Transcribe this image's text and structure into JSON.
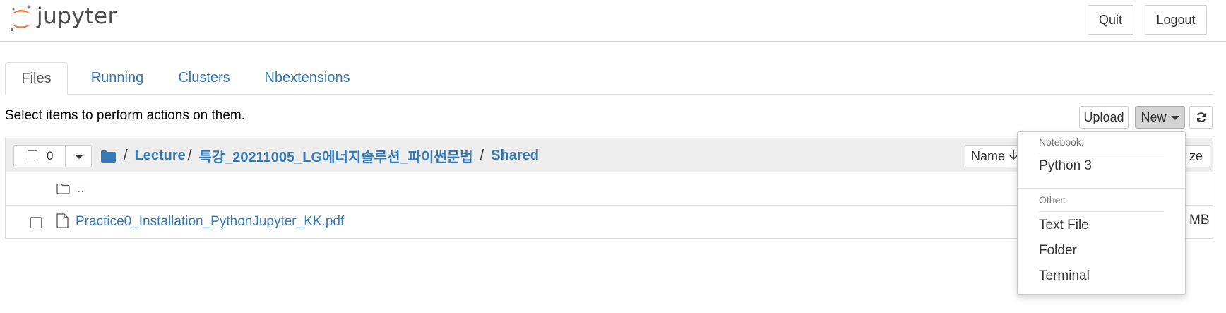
{
  "header": {
    "logo_text": "jupyter",
    "quit_label": "Quit",
    "logout_label": "Logout",
    "logo_colors": {
      "orange": "#F37726",
      "gray": "#767677"
    }
  },
  "tabs": [
    {
      "label": "Files",
      "active": true
    },
    {
      "label": "Running",
      "active": false
    },
    {
      "label": "Clusters",
      "active": false
    },
    {
      "label": "Nbextensions",
      "active": false
    }
  ],
  "toolbar": {
    "instructions": "Select items to perform actions on them.",
    "upload_label": "Upload",
    "new_label": "New",
    "refresh_icon": "refresh-icon"
  },
  "list": {
    "selected_count": "0",
    "breadcrumb": [
      {
        "label": "Lecture"
      },
      {
        "label": "특강_20211005_LG에너지솔루션_파이썬문법"
      },
      {
        "label": "Shared"
      }
    ],
    "separator": "/",
    "sort_name_label": "Name",
    "sort_size_label": "ze",
    "rows": [
      {
        "name": "..",
        "icon": "folder-icon"
      },
      {
        "name": "Practice0_Installation_PythonJupyter_KK.pdf",
        "icon": "file-icon",
        "size": "MB"
      }
    ]
  },
  "new_menu": {
    "notebook_header": "Notebook:",
    "notebook_items": [
      "Python 3"
    ],
    "other_header": "Other:",
    "other_items": [
      "Text File",
      "Folder",
      "Terminal"
    ]
  },
  "colors": {
    "link": "#337ab7",
    "tab_border": "#dddddd",
    "list_header_bg": "#eeeeee",
    "new_button_active": "#d4d4d4"
  }
}
